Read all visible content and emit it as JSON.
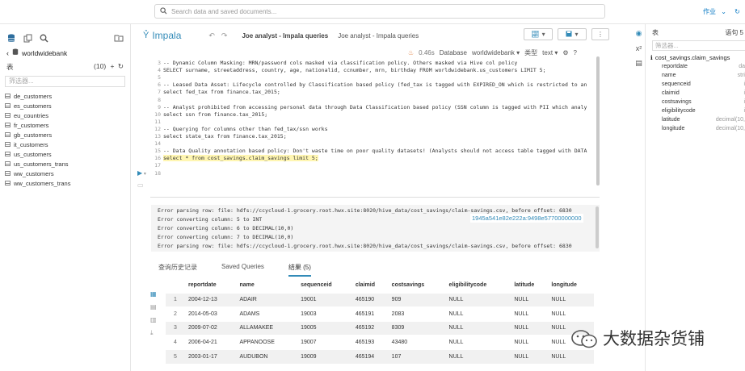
{
  "topbar": {
    "search_placeholder": "Search data and saved documents...",
    "jobs_label": "作业"
  },
  "left": {
    "database": "worldwidebank",
    "tables_label": "表",
    "tables_count": "(10)",
    "filter_placeholder": "筛选器...",
    "tables": [
      "de_customers",
      "es_customers",
      "eu_countries",
      "fr_customers",
      "gb_customers",
      "it_customers",
      "us_customers",
      "us_customers_trans",
      "ww_customers",
      "ww_customers_trans"
    ]
  },
  "editor": {
    "engine": "Impala",
    "query_title": "Joe analyst - Impala queries",
    "query_desc": "Joe analyst - Impala queries",
    "exec_time": "0.46s",
    "db_label": "Database",
    "db_value": "worldwidebank",
    "type_label": "类型",
    "type_value": "text",
    "lines": [
      {
        "n": "3",
        "t": "-- Dynamic Column Masking: MRN/password cols masked via classification policy. Others masked via Hive col policy",
        "c": "cm"
      },
      {
        "n": "4",
        "t": "SELECT surname, streetaddress, country, age, nationalid, ccnumber, mrn, birthday FROM worldwidebank.us_customers LIMIT 5;",
        "c": ""
      },
      {
        "n": "5",
        "t": "",
        "c": ""
      },
      {
        "n": "6",
        "t": "-- Leased Data Asset: Lifecycle controlled by Classification based policy (fed_tax is tagged with EXPIRED_ON which is restricted to an",
        "c": "cm"
      },
      {
        "n": "7",
        "t": "select fed_tax from finance.tax_2015;",
        "c": ""
      },
      {
        "n": "8",
        "t": "",
        "c": ""
      },
      {
        "n": "9",
        "t": "-- Analyst prohibited from accessing personal data through Data Classification based policy (SSN column is tagged with PII which analy",
        "c": "cm"
      },
      {
        "n": "10",
        "t": "select ssn from finance.tax_2015;",
        "c": ""
      },
      {
        "n": "11",
        "t": "",
        "c": ""
      },
      {
        "n": "12",
        "t": "-- Querying for columns other than fed_tax/ssn works",
        "c": "cm"
      },
      {
        "n": "13",
        "t": "select state_tax from finance.tax_2015;",
        "c": ""
      },
      {
        "n": "14",
        "t": "",
        "c": ""
      },
      {
        "n": "15",
        "t": "-- Data Quality annotation based policy: Don't waste time on poor quality datasets! (Analysts should not access table tagged with DATA",
        "c": "cm"
      },
      {
        "n": "16",
        "t": "select * from cost_savings.claim_savings limit 5;",
        "c": "hl"
      },
      {
        "n": "17",
        "t": "",
        "c": ""
      },
      {
        "n": "18",
        "t": "",
        "c": ""
      }
    ]
  },
  "log": {
    "lines": [
      "Error parsing row: file: hdfs://ccycloud-1.grocery.root.hwx.site:8020/hive_data/cost_savings/claim-savings.csv, before offset: 6830",
      "Error converting column: 5 to INT",
      "Error converting column: 6 to DECIMAL(10,0)",
      "Error converting column: 7 to DECIMAL(10,0)",
      "Error parsing row: file: hdfs://ccycloud-1.grocery.root.hwx.site:8020/hive_data/cost_savings/claim-savings.csv, before offset: 6830"
    ],
    "job_id": "1945a541e82e222a:9498e57700000000"
  },
  "tabs": {
    "history": "查询历史记录",
    "saved": "Saved Queries",
    "results": "结果 (5)"
  },
  "results": {
    "columns": [
      "reportdate",
      "name",
      "sequenceid",
      "claimid",
      "costsavings",
      "eligibilitycode",
      "latitude",
      "longitude"
    ],
    "rows": [
      [
        "1",
        "2004-12-13",
        "ADAIR",
        "19001",
        "465190",
        "909",
        "NULL",
        "NULL",
        "NULL"
      ],
      [
        "2",
        "2014-05-03",
        "ADAMS",
        "19003",
        "465191",
        "2083",
        "NULL",
        "NULL",
        "NULL"
      ],
      [
        "3",
        "2009-07-02",
        "ALLAMAKEE",
        "19005",
        "465192",
        "8309",
        "NULL",
        "NULL",
        "NULL"
      ],
      [
        "4",
        "2006-04-21",
        "APPANOOSE",
        "19007",
        "465193",
        "43480",
        "NULL",
        "NULL",
        "NULL"
      ],
      [
        "5",
        "2003-01-17",
        "AUDUBON",
        "19009",
        "465194",
        "107",
        "NULL",
        "NULL",
        "NULL"
      ]
    ]
  },
  "right": {
    "tables_label": "表",
    "statement_label": "语句 5",
    "filter_placeholder": "筛选器...",
    "table_name": "cost_savings.claim_savings",
    "columns": [
      {
        "name": "reportdate",
        "type": "da"
      },
      {
        "name": "name",
        "type": "stri"
      },
      {
        "name": "sequenceid",
        "type": "i"
      },
      {
        "name": "claimid",
        "type": "i"
      },
      {
        "name": "costsavings",
        "type": "i"
      },
      {
        "name": "eligibilitycode",
        "type": "i"
      },
      {
        "name": "latitude",
        "type": "decimal(10,"
      },
      {
        "name": "longitude",
        "type": "decimal(10,"
      }
    ]
  },
  "watermark": {
    "text": "大数据杂货铺"
  }
}
